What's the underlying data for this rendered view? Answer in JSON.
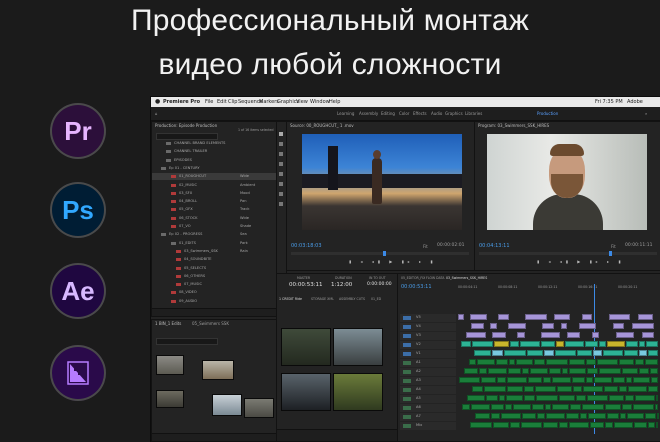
{
  "headline": {
    "line1": "Профессиональный монтаж",
    "line2": "видео любой сложности"
  },
  "apps": [
    {
      "label": "Pr",
      "bg": "#2c0f3a",
      "fg": "#e7b5ff",
      "icon": "premiere-icon"
    },
    {
      "label": "Ps",
      "bg": "#001d34",
      "fg": "#31a8ff",
      "icon": "photoshop-icon"
    },
    {
      "label": "Ae",
      "bg": "#1f0740",
      "fg": "#d7b8ff",
      "icon": "after-effects-icon"
    },
    {
      "label": "",
      "bg": "#2a0a4a",
      "fg": "#b67cff",
      "icon": "media-encoder-icon"
    }
  ],
  "menubar": {
    "app": "Premiere Pro",
    "items": [
      "File",
      "Edit",
      "Clip",
      "Sequence",
      "Markers",
      "Graphics",
      "View",
      "Window",
      "Help"
    ],
    "clock": "Fri 7:35 PM",
    "user": "Adobe"
  },
  "workspaces": [
    "Learning",
    "Assembly",
    "Editing",
    "Color",
    "Effects",
    "Audio",
    "Graphics",
    "Libraries",
    "Production"
  ],
  "project_panel": {
    "title": "Production: Episode Production",
    "items_label": "1 of 16 items selected",
    "rows": [
      "CHANNEL BRAND ELEMENTS",
      "CHANNEL TRAILER",
      "EPISODES",
      "Ep 01 - CENTURY",
      "01_ROUGHCUT",
      "02_MUSIC",
      "03_SFX",
      "04_BROLL",
      "05_GFX",
      "06_STOCK",
      "07_VO",
      "Ep 02 - PROGRESS",
      "01_EDITS",
      "03_Swimmers_SSK",
      "04_SOUNDBITE",
      "05_SELECTS",
      "06_OTHERS",
      "07_MUSIC",
      "08_VIDEO",
      "09_AUDIO"
    ],
    "tags": [
      "Wide",
      "Ambient",
      "Mood",
      "Pan",
      "Track",
      "Wide",
      "Shade",
      "Sea",
      "Park",
      "Rain"
    ]
  },
  "bin_panel": {
    "title": "1 BIN_1 Edits",
    "subtitle": "05_Swimmers SSK"
  },
  "source_monitor": {
    "title": "Source: 00_ROUGHCUT_ 1 .mov",
    "timecode_left": "00:03:18:03",
    "fit": "Fit",
    "timecode_right": "00:00:02:01"
  },
  "program_monitor": {
    "title": "Program: 03_Swimmers_SSK_HIRES",
    "timecode_left": "00:04:13:11",
    "fit": "Fit",
    "timecode_right": "00:00:11:11"
  },
  "preview_panel": {
    "tabs": [
      "1 CREDIT Ride",
      "STORAGE XML",
      "ASSEMBLY CUTS",
      "01_ED"
    ],
    "timecode": "00:00:53:11",
    "duration": "1:12:00",
    "end": "0:00:00:00",
    "labels": [
      "MASTER",
      "DURATION",
      "IN TO OUT",
      "END"
    ]
  },
  "timeline": {
    "tabs": [
      "05_EDITOR_FIX",
      "FLOW DATA",
      "03_Swimmers_SSK_HIRES"
    ],
    "timecode": "00:00:53:11",
    "ruler": [
      "00:00:04:11",
      "00:00:08:11",
      "00:00:12:11",
      "00:00:16:11",
      "00:00:20:11"
    ],
    "tracks": [
      "V5",
      "V4",
      "V3",
      "V2",
      "V1",
      "A1",
      "A2",
      "A3",
      "A4",
      "A5",
      "A6",
      "A7",
      "Mix"
    ]
  },
  "colors": {
    "accent_blue": "#3c8ae6",
    "clip_purple": "#a695d8",
    "clip_teal": "#2db395",
    "clip_green": "#1a7e3a",
    "clip_yellow": "#c9b42c"
  }
}
